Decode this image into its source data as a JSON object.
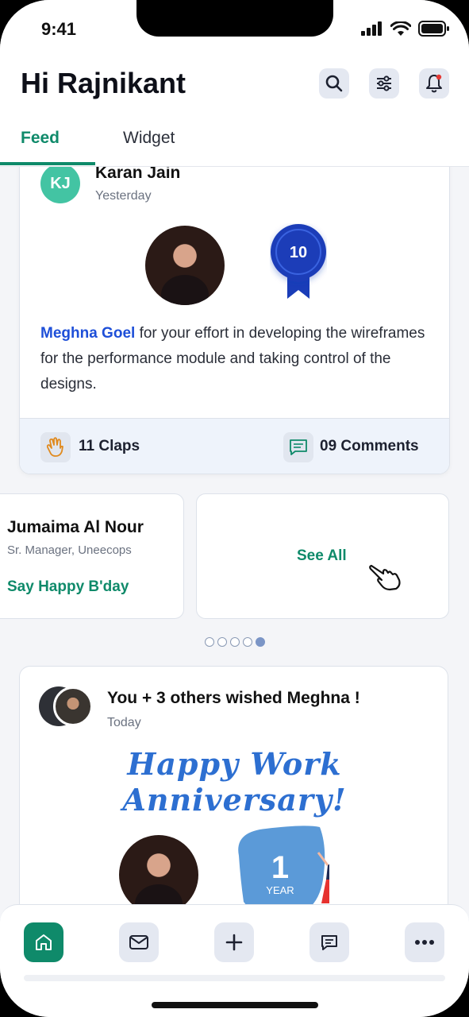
{
  "status_bar": {
    "time": "9:41"
  },
  "header": {
    "greeting": "Hi Rajnikant",
    "tabs": [
      {
        "label": "Feed"
      },
      {
        "label": "Widget"
      }
    ]
  },
  "post1": {
    "author_initials": "KJ",
    "author": "Karan Jain",
    "time": "Yesterday",
    "badge_number": "10",
    "mention": "Meghna Goel",
    "text": " for your effort in developing the wireframes for the performance module and taking control of the designs.",
    "claps": "11 Claps",
    "comments": "09 Comments"
  },
  "birthday_card": {
    "name": "Jumaima Al Nour",
    "role": "Sr. Manager, Uneecops",
    "action": "Say Happy B'day"
  },
  "see_all": {
    "label": "See All"
  },
  "carousel": {
    "count": 5,
    "active": 5
  },
  "post2": {
    "title": "You + 3 others wished Meghna !",
    "time": "Today",
    "headline": "Happy Work Anniversary!",
    "year_number": "1",
    "year_label": "YEAR"
  },
  "colors": {
    "accent": "#0f8a6a",
    "mention": "#1e4fd8",
    "badge": "#1a3db8"
  }
}
